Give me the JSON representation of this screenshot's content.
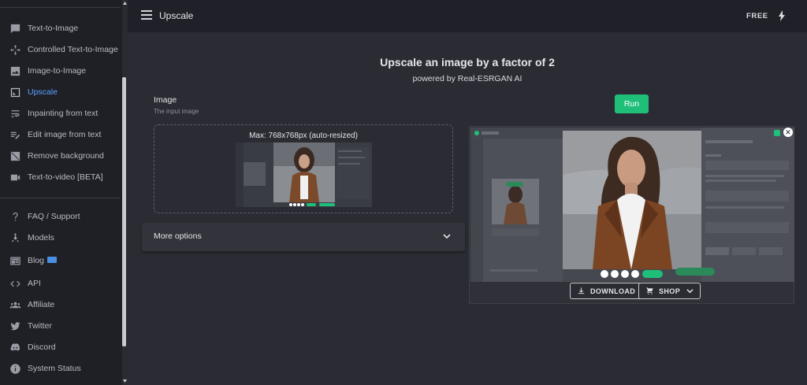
{
  "sidebar": {
    "items": [
      {
        "label": "Text-to-Image",
        "icon": "chat-icon",
        "active": false
      },
      {
        "label": "Controlled Text-to-Image",
        "icon": "move-icon",
        "active": false
      },
      {
        "label": "Image-to-Image",
        "icon": "image-icon",
        "active": false
      },
      {
        "label": "Upscale",
        "icon": "upscale-icon",
        "active": true
      },
      {
        "label": "Inpainting from text",
        "icon": "wrap-text-icon",
        "active": false
      },
      {
        "label": "Edit image from text",
        "icon": "edit-note-icon",
        "active": false
      },
      {
        "label": "Remove background",
        "icon": "hide-image-icon",
        "active": false
      },
      {
        "label": "Text-to-video [BETA]",
        "icon": "videocam-icon",
        "active": false
      }
    ],
    "secondary": [
      {
        "label": "FAQ / Support",
        "icon": "question-icon"
      },
      {
        "label": "Models",
        "icon": "hub-icon"
      },
      {
        "label": "Blog",
        "icon": "newspaper-icon",
        "badge": true
      },
      {
        "label": "API",
        "icon": "code-icon"
      },
      {
        "label": "Affiliate",
        "icon": "group-icon"
      },
      {
        "label": "Twitter",
        "icon": "twitter-icon"
      },
      {
        "label": "Discord",
        "icon": "discord-icon"
      },
      {
        "label": "System Status",
        "icon": "info-icon"
      }
    ]
  },
  "header": {
    "title": "Upscale",
    "plan": "FREE"
  },
  "main": {
    "title": "Upscale an image by a factor of 2",
    "subtitle": "powered by Real-ESRGAN AI",
    "image_label": "Image",
    "image_hint": "The input image",
    "dropzone_label": "Max: 768x768px (auto-resized)",
    "more_options": "More options",
    "run": "Run",
    "download": "DOWNLOAD",
    "shop": "SHOP"
  },
  "colors": {
    "accent": "#1fbf7a",
    "active_link": "#5aa0ff",
    "background": "#2b2c33",
    "sidebar": "#1f2026"
  }
}
